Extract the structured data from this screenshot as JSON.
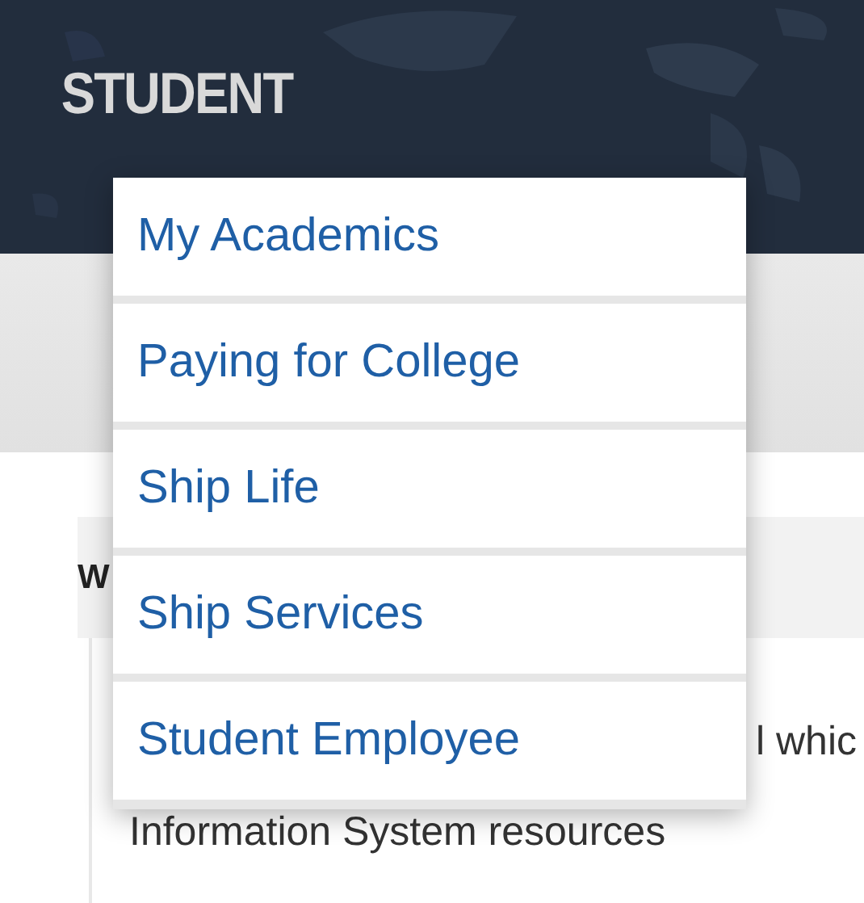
{
  "header": {
    "title": "STUDENT"
  },
  "menu": {
    "items": [
      {
        "label": "My Academics"
      },
      {
        "label": "Paying for College"
      },
      {
        "label": "Ship Life"
      },
      {
        "label": "Ship Services"
      },
      {
        "label": "Student Employee"
      }
    ]
  },
  "panel": {
    "heading": "W",
    "lines": [
      "l whic",
      "Information System resources"
    ]
  }
}
